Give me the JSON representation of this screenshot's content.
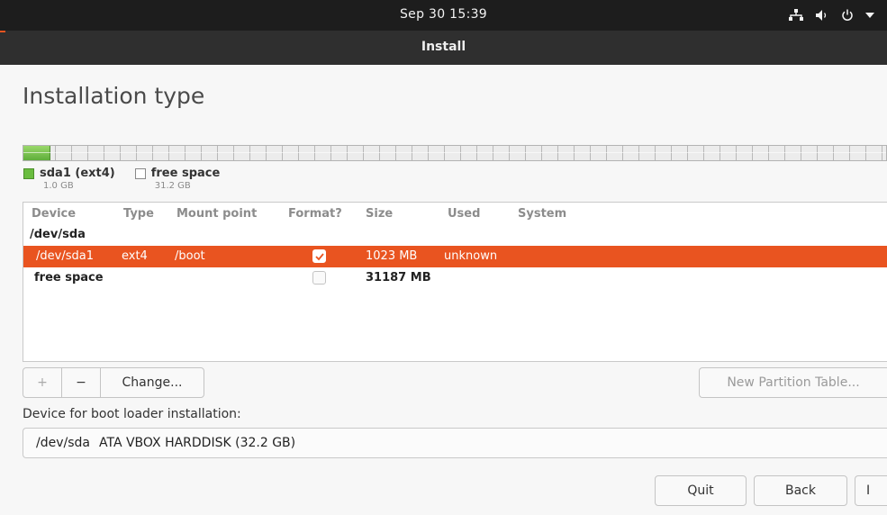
{
  "topbar": {
    "clock": "Sep 30  15:39"
  },
  "window": {
    "title": "Install"
  },
  "page": {
    "heading": "Installation type"
  },
  "partition_bar": {
    "used_fraction": 0.031,
    "used_color": "#6abd3f"
  },
  "legend": [
    {
      "label": "sda1 (ext4)",
      "size": "1.0 GB",
      "swatch": "green"
    },
    {
      "label": "free space",
      "size": "31.2 GB",
      "swatch": "empty"
    }
  ],
  "table": {
    "headers": {
      "device": "Device",
      "type": "Type",
      "mount": "Mount point",
      "format": "Format?",
      "size": "Size",
      "used": "Used",
      "system": "System"
    },
    "device_row": {
      "device": "/dev/sda"
    },
    "rows": [
      {
        "device": "/dev/sda1",
        "type": "ext4",
        "mount": "/boot",
        "format_checked": true,
        "size": "1023 MB",
        "used": "unknown",
        "system": ""
      },
      {
        "device": "free space",
        "type": "",
        "mount": "",
        "format_checked": false,
        "size": "31187 MB",
        "used": "",
        "system": ""
      }
    ]
  },
  "controls": {
    "add_label": "+",
    "remove_label": "−",
    "change_label": "Change...",
    "new_table_label": "New Partition Table..."
  },
  "bootloader": {
    "label": "Device for boot loader installation:",
    "device": "/dev/sda",
    "description": "ATA VBOX HARDDISK (32.2 GB)"
  },
  "buttons": {
    "quit": "Quit",
    "back": "Back",
    "install_partial": "I"
  },
  "colors": {
    "accent": "#e95420",
    "topbar": "#1d1d1d",
    "titlebar": "#2f2f2f"
  },
  "icons": [
    "network-icon",
    "volume-icon",
    "power-icon",
    "menu-arrow-icon",
    "checkmark-icon"
  ]
}
